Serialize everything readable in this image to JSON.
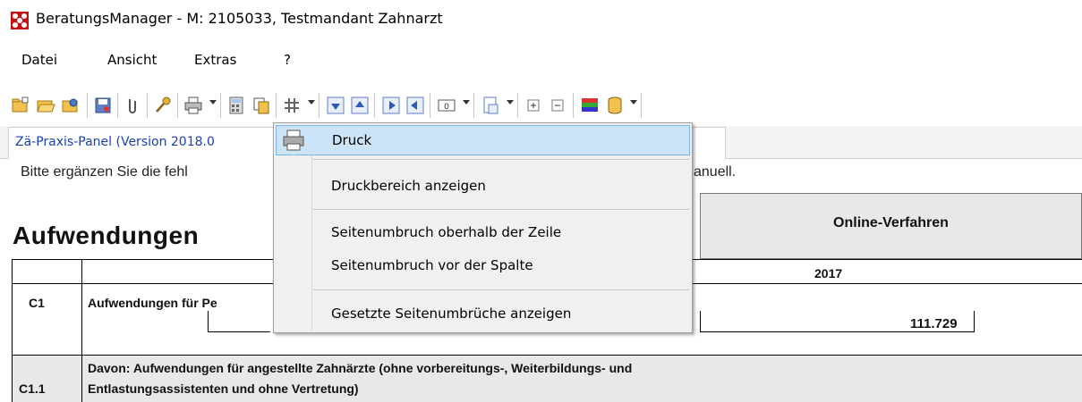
{
  "window": {
    "title": "BeratungsManager - M: 2105033, Testmandant Zahnarzt"
  },
  "menubar": {
    "items": [
      "Datei",
      "Ansicht",
      "Extras",
      "?"
    ]
  },
  "tab": {
    "label": "Zä-Praxis-Panel (Version 2018.0"
  },
  "hint": {
    "left": "Bitte ergänzen Sie die fehl",
    "right": "anuell."
  },
  "section": {
    "heading": "Aufwendungen"
  },
  "online": {
    "label": "Online-Verfahren"
  },
  "table": {
    "year": "2017",
    "rows": [
      {
        "code": "C1",
        "label": "Aufwendungen für Pe",
        "value": "111.729"
      },
      {
        "code": "C1.1",
        "label_line1": "Davon: Aufwendungen für angestellte Zahnärzte (ohne vorbereitungs-, Weiterbildungs- und",
        "label_line2": "Entlastungsassistenten und ohne Vertretung)"
      }
    ]
  },
  "context_menu": {
    "items": [
      "Druck",
      "Druckbereich anzeigen",
      "Seitenumbruch oberhalb der Zeile",
      "Seitenumbruch vor der Spalte",
      "Gesetzte Seitenumbrüche anzeigen"
    ],
    "highlighted": "Druck"
  },
  "toolbar": {
    "icons": [
      "new-folder-icon",
      "open-folder-icon",
      "folder-settings-icon",
      "save-icon",
      "attach-icon",
      "key-icon",
      "print-icon",
      "calculator-icon",
      "copy-icon",
      "grid-icon",
      "arrow-down-icon",
      "arrow-up-icon",
      "arrow-right-icon",
      "arrow-left-icon",
      "counter-icon",
      "page-icon",
      "expand-icon",
      "collapse-icon",
      "color-icon",
      "database-icon"
    ]
  },
  "colors": {
    "accent": "#1a3fb5",
    "menu_highlight": "#cce4f7",
    "menu_highlight_border": "#7eb4ea",
    "header_grey": "#e8e8e8"
  }
}
